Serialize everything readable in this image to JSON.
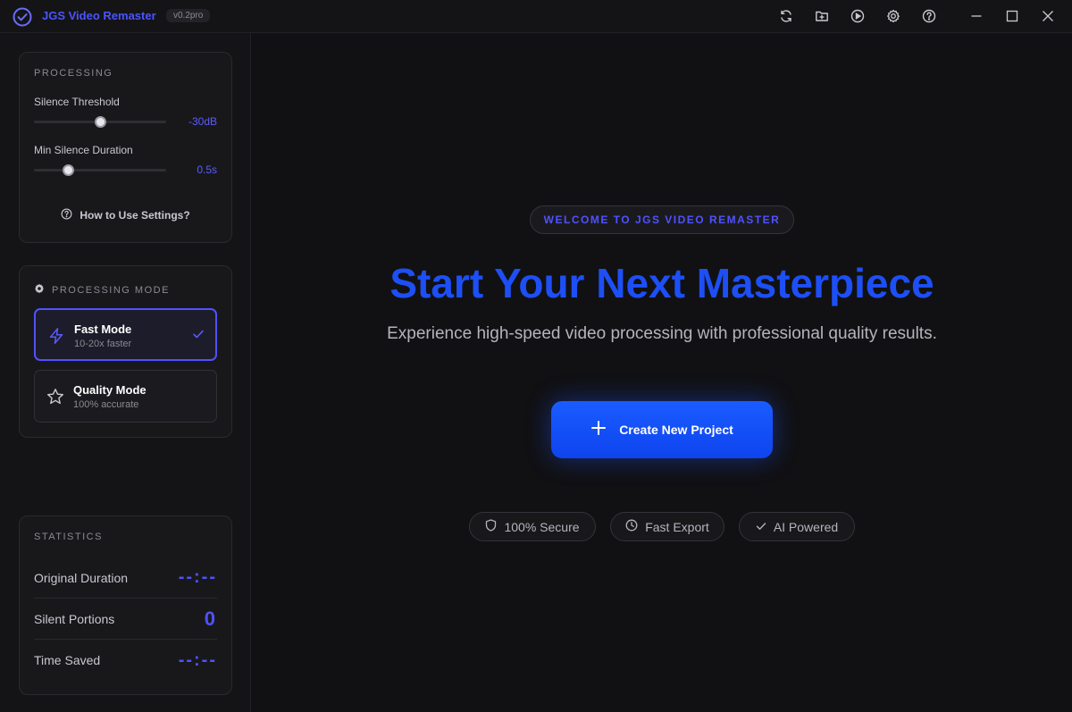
{
  "app": {
    "title": "JGS Video Remaster",
    "version": "v0.2pro"
  },
  "toolbar": {
    "icons": [
      "refresh-icon",
      "folder-icon",
      "play-icon",
      "gear-icon",
      "help-icon"
    ]
  },
  "processing": {
    "section_label": "PROCESSING",
    "silence_threshold": {
      "label": "Silence Threshold",
      "value": "-30dB",
      "level": 0.5
    },
    "min_silence_duration": {
      "label": "Min Silence Duration",
      "value": "0.5s",
      "level": 0.24
    },
    "how_to_label": "How to Use Settings?"
  },
  "processing_mode": {
    "section_label": "PROCESSING MODE",
    "modes": [
      {
        "title": "Fast Mode",
        "subtitle": "10-20x faster",
        "selected": true
      },
      {
        "title": "Quality Mode",
        "subtitle": "100% accurate",
        "selected": false
      }
    ]
  },
  "statistics": {
    "section_label": "STATISTICS",
    "rows": [
      {
        "label": "Original Duration",
        "value": "--:--"
      },
      {
        "label": "Silent Portions",
        "value": "0"
      },
      {
        "label": "Time Saved",
        "value": "--:--"
      }
    ]
  },
  "main": {
    "welcome": "WELCOME TO JGS VIDEO REMASTER",
    "headline": "Start Your Next Masterpiece",
    "subheadline": "Experience high-speed video processing with professional quality results.",
    "cta_label": "Create New Project",
    "badges": [
      "100% Secure",
      "Fast Export",
      "AI Powered"
    ]
  },
  "colors": {
    "accent": "#4f52ff",
    "brand_blue": "#1d4ff5",
    "background": "#111113"
  }
}
